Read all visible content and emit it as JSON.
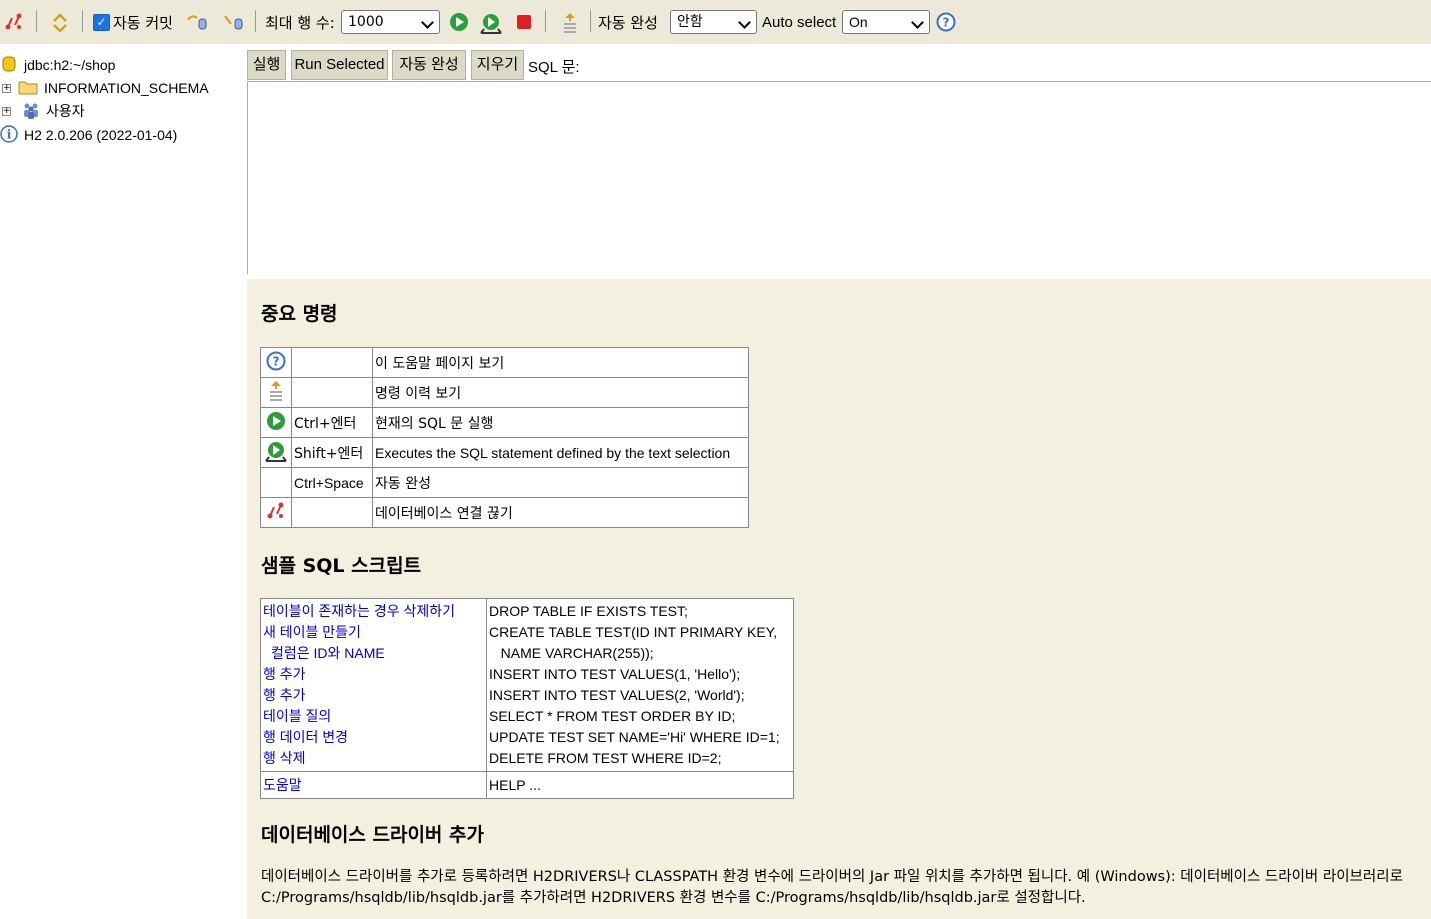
{
  "toolbar": {
    "autocommit_label": "자동 커밋",
    "autocommit_checked": true,
    "max_rows_label": "최대 행 수:",
    "max_rows_value": "1000",
    "autocomplete_label": "자동 완성",
    "autocomplete_value": "안함",
    "autoselect_label": "Auto select",
    "autoselect_value": "On"
  },
  "tree": {
    "connection": "jdbc:h2:~/shop",
    "items": [
      {
        "label": "INFORMATION_SCHEMA",
        "icon": "folder-icon"
      },
      {
        "label": "사용자",
        "icon": "users-icon"
      }
    ],
    "version": "H2 2.0.206 (2022-01-04)"
  },
  "query": {
    "run_label": "실행",
    "run_selected_label": "Run Selected",
    "autocomplete_label": "자동 완성",
    "clear_label": "지우기",
    "sql_label": "SQL 문:",
    "sql_text": ""
  },
  "help": {
    "important_title": "중요 명령",
    "commands": [
      {
        "icon": "help-icon",
        "key": "",
        "desc": "이 도움말 페이지 보기"
      },
      {
        "icon": "history-icon",
        "key": "",
        "desc": "명령 이력 보기"
      },
      {
        "icon": "run-icon",
        "key": "Ctrl+엔터",
        "desc": "현재의 SQL 문 실행"
      },
      {
        "icon": "run-selected-icon",
        "key": "Shift+엔터",
        "desc": "Executes the SQL statement defined by the text selection"
      },
      {
        "icon": "",
        "key": "Ctrl+Space",
        "desc": "자동 완성"
      },
      {
        "icon": "disconnect-icon",
        "key": "",
        "desc": "데이터베이스 연결 끊기"
      }
    ],
    "sample_title": "샘플 SQL 스크립트",
    "sample_links": [
      "테이블이 존재하는 경우 삭제하기",
      "새 테이블 만들기",
      "  컬럼은 ID와 NAME",
      "행 추가",
      "행 추가",
      "테이블 질의",
      "행 데이터 변경",
      "행 삭제"
    ],
    "sample_code": [
      "DROP TABLE IF EXISTS TEST;",
      "CREATE TABLE TEST(ID INT PRIMARY KEY,",
      "   NAME VARCHAR(255));",
      "INSERT INTO TEST VALUES(1, 'Hello');",
      "INSERT INTO TEST VALUES(2, 'World');",
      "SELECT * FROM TEST ORDER BY ID;",
      "UPDATE TEST SET NAME='Hi' WHERE ID=1;",
      "DELETE FROM TEST WHERE ID=2;"
    ],
    "help_link": "도움말",
    "help_code": "HELP ...",
    "driver_title": "데이터베이스 드라이버 추가",
    "driver_text": "데이터베이스 드라이버를 추가로 등록하려면 H2DRIVERS나 CLASSPATH 환경 변수에 드라이버의 Jar 파일 위치를 추가하면 됩니다. 예 (Windows): 데이터베이스 드라이버 라이브러리로 C:/Programs/hsqldb/lib/hsqldb.jar를 추가하려면 H2DRIVERS 환경 변수를 C:/Programs/hsqldb/lib/hsqldb.jar로 설정합니다."
  }
}
